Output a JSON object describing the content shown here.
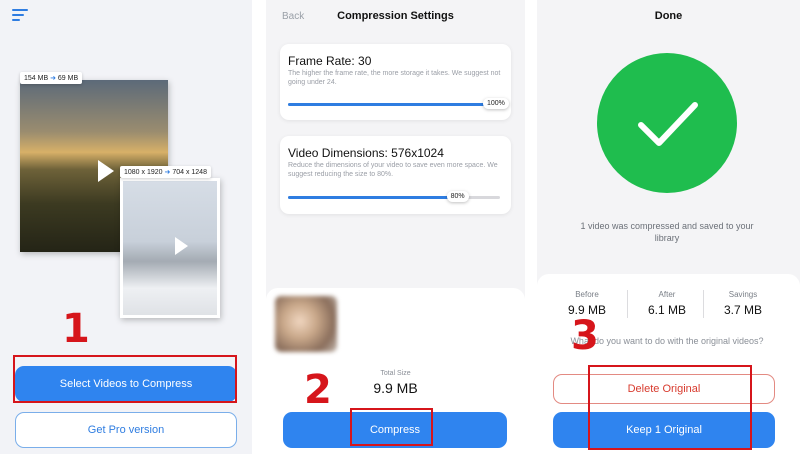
{
  "panel1": {
    "menu_icon": "hamburger-menu-icon",
    "tag_large": {
      "before": "154 MB",
      "after": "69 MB"
    },
    "tag_small": {
      "before": "1080 x 1920",
      "after": "704 x 1248"
    },
    "arrow_glyph": "➜",
    "step_number": "1",
    "select_button": "Select Videos to Compress",
    "pro_button": "Get Pro version"
  },
  "panel2": {
    "back": "Back",
    "title": "Compression Settings",
    "frame_rate": {
      "title": "Frame Rate: 30",
      "description": "The higher the frame rate, the more storage it takes. We suggest not going under 24.",
      "percent_label": "100%",
      "percent_value": 100
    },
    "dimensions": {
      "title": "Video Dimensions: 576x1024",
      "description": "Reduce the dimensions of your video to save even more space. We suggest reducing the size to 80%.",
      "percent_label": "80%",
      "percent_value": 80
    },
    "total_size_label": "Total Size",
    "total_size_value": "9.9 MB",
    "step_number": "2",
    "compress_button": "Compress"
  },
  "panel3": {
    "title": "Done",
    "check_icon": "checkmark-icon",
    "message": "1 video was compressed and saved to your library",
    "stats": [
      {
        "label": "Before",
        "value": "9.9 MB"
      },
      {
        "label": "After",
        "value": "6.1 MB"
      },
      {
        "label": "Savings",
        "value": "3.7 MB"
      }
    ],
    "question": "What do you want to do with the original videos?",
    "step_number": "3",
    "delete_button": "Delete Original",
    "keep_button": "Keep 1 Original"
  },
  "colors": {
    "accent": "#2f84ef",
    "success": "#1fbd4e",
    "danger": "#d83b2e",
    "annotation": "#d6151b"
  }
}
